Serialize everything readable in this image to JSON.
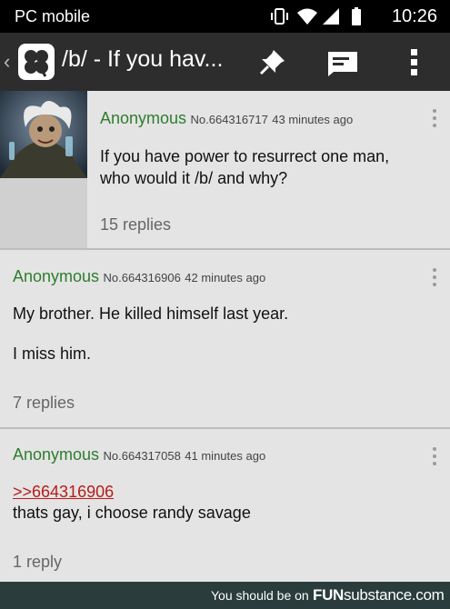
{
  "status_bar": {
    "carrier": "PC mobile",
    "time": "10:26",
    "icons": [
      "vibrate-icon",
      "wifi-icon",
      "signal-icon",
      "battery-icon"
    ]
  },
  "action_bar": {
    "back_glyph": "‹",
    "title": "/b/ - If you hav...",
    "actions": [
      "pin-icon",
      "reply-icon",
      "more-icon"
    ]
  },
  "posts": [
    {
      "name": "Anonymous",
      "post_no": "No.664316717",
      "time": "43 minutes ago",
      "lines": [
        "If you have power to resurrect one man,",
        "who would it /b/ and why?"
      ],
      "replies": "15 replies",
      "has_thumbnail": true
    },
    {
      "name": "Anonymous",
      "post_no": "No.664316906",
      "time": "42 minutes ago",
      "lines": [
        "My brother. He killed himself last year.",
        "I miss him."
      ],
      "replies": "7 replies"
    },
    {
      "name": "Anonymous",
      "post_no": "No.664317058",
      "time": "41 minutes ago",
      "quote": ">>664316906",
      "lines": [
        "thats gay, i choose randy savage"
      ],
      "replies": "1 reply"
    }
  ],
  "footer": {
    "message": "You should be on",
    "site_bold": "FUN",
    "site_thin": "substance",
    "site_tld": ".com"
  },
  "colors": {
    "name_green": "#2f7d2f",
    "quote_red": "#b71c1c",
    "action_bar": "#2d2d2d",
    "footer": "#2a3d3c"
  }
}
